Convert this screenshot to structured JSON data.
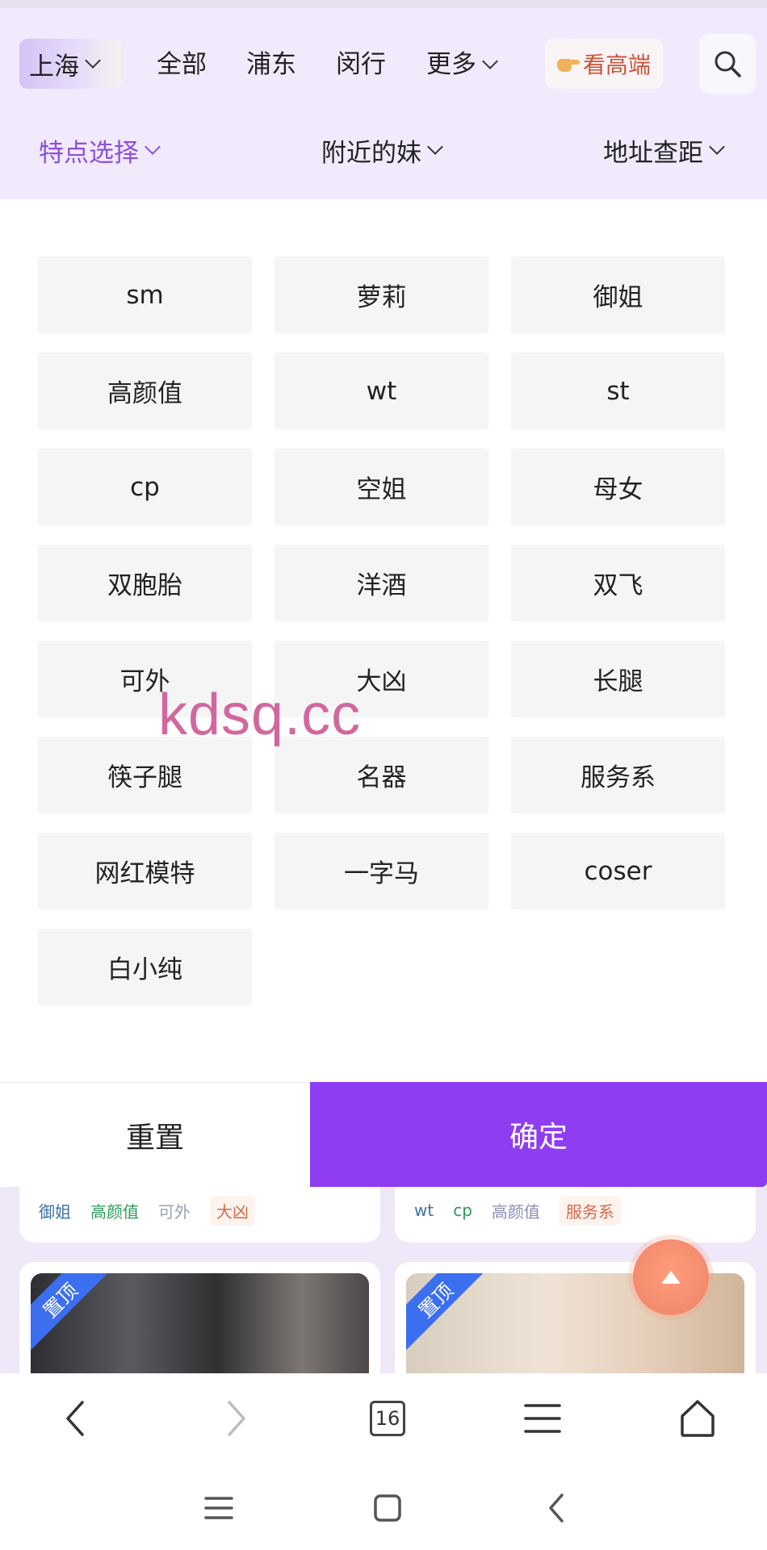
{
  "header": {
    "city": "上海",
    "nav": [
      "全部",
      "浦东",
      "闵行"
    ],
    "more_label": "更多",
    "premium_label": "看高端",
    "search_icon": "search-icon"
  },
  "filters": {
    "features": "特点选择",
    "nearby": "附近的妹",
    "distance": "地址查距"
  },
  "tags": [
    "sm",
    "萝莉",
    "御姐",
    "高颜值",
    "wt",
    "st",
    "cp",
    "空姐",
    "母女",
    "双胞胎",
    "洋酒",
    "双飞",
    "可外",
    "大凶",
    "长腿",
    "筷子腿",
    "名器",
    "服务系",
    "网红模特",
    "一字马",
    "coser",
    "白小纯"
  ],
  "watermark": "kdsq.cc",
  "actions": {
    "reset": "重置",
    "confirm": "确定"
  },
  "cards": {
    "left_tags": [
      "御姐",
      "高颜值",
      "可外",
      "大凶"
    ],
    "right_tags": [
      "wt",
      "cp",
      "高颜值",
      "服务系"
    ],
    "pinned_label": "置顶"
  },
  "browser": {
    "tab_count": "16"
  },
  "colors": {
    "accent": "#8e3df0",
    "header_bg": "#f1eafc",
    "tag_bg": "#f5f5f5",
    "watermark": "#d2679e",
    "ribbon": "#3b6ff0"
  }
}
